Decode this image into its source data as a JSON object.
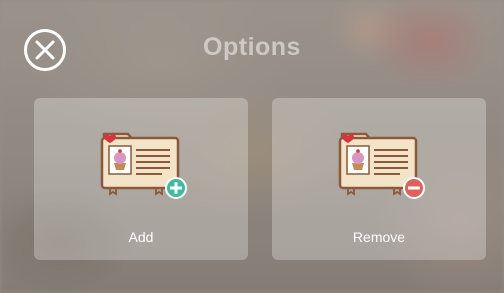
{
  "header": {
    "title": "Options"
  },
  "options": [
    {
      "label": "Add",
      "icon": "recipe-folder-add-icon",
      "badge_color": "#3dbd9c"
    },
    {
      "label": "Remove",
      "icon": "recipe-folder-remove-icon",
      "badge_color": "#e0605c"
    }
  ],
  "colors": {
    "folder": "#f3e4c8",
    "folder_outline": "#8b5a3c",
    "heart": "#d8353a",
    "cupcake_frosting": "#d996c2"
  }
}
